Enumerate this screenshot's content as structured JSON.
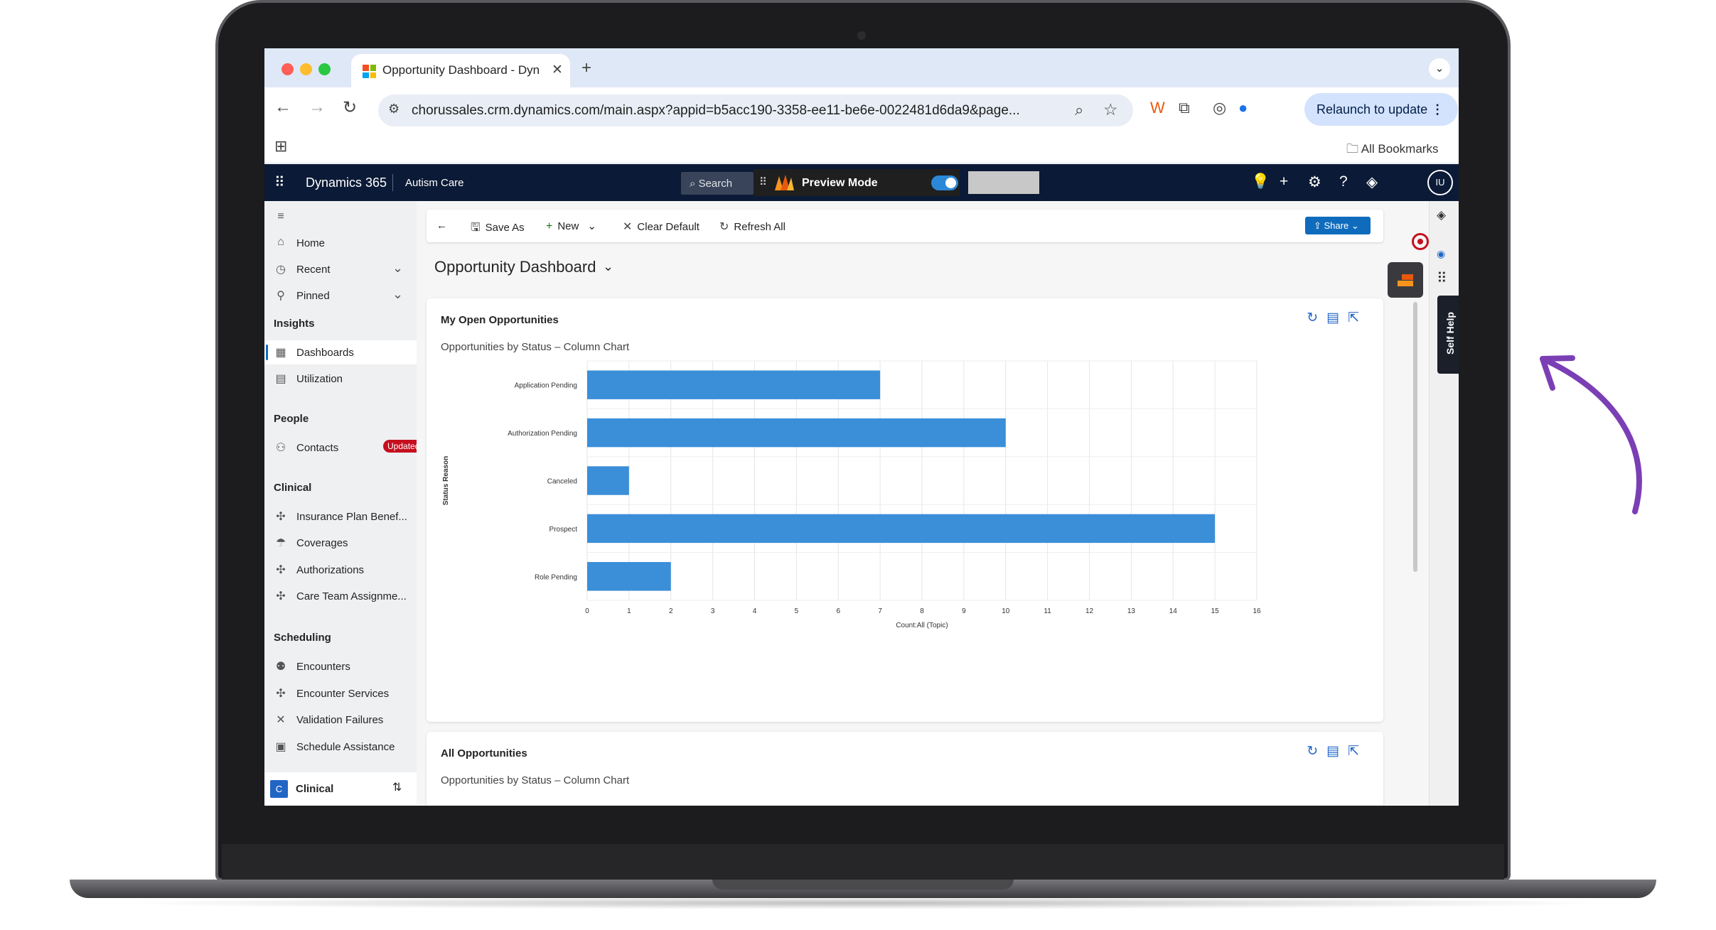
{
  "browser": {
    "tab_title": "Opportunity Dashboard - Dyn",
    "tab_close": "✕",
    "new_tab": "+",
    "url": "chorussales.crm.dynamics.com/main.aspx?appid=b5acc190-3358-ee11-be6e-0022481d6da9&page...",
    "relaunch_label": "Relaunch to update",
    "all_bookmarks": "All Bookmarks"
  },
  "header": {
    "product": "Dynamics 365",
    "app": "Autism Care",
    "search_label": "Search",
    "preview_label": "Preview Mode",
    "avatar_initials": "IU"
  },
  "sitemap": {
    "home": "Home",
    "recent": "Recent",
    "pinned": "Pinned",
    "insights_group": "Insights",
    "dashboards": "Dashboards",
    "utilization": "Utilization",
    "people_group": "People",
    "contacts": "Contacts",
    "updated_badge": "Updated",
    "clinical_group": "Clinical",
    "insurance": "Insurance Plan Benef...",
    "coverages": "Coverages",
    "authorizations": "Authorizations",
    "care_team": "Care Team Assignme...",
    "scheduling_group": "Scheduling",
    "encounters": "Encounters",
    "encounter_services": "Encounter Services",
    "validation_failures": "Validation Failures",
    "schedule_assistance": "Schedule Assistance",
    "area_tile": "C",
    "area_name": "Clinical"
  },
  "commands": {
    "save_as": "Save As",
    "new": "New",
    "clear_default": "Clear Default",
    "refresh_all": "Refresh All",
    "share": "Share"
  },
  "dashboard": {
    "title": "Opportunity Dashboard"
  },
  "cards": [
    {
      "title": "My Open Opportunities",
      "subtitle": "Opportunities by Status – Column Chart"
    },
    {
      "title": "All Opportunities",
      "subtitle": "Opportunities by Status – Column Chart"
    }
  ],
  "side": {
    "self_help": "Self Help"
  },
  "colors": {
    "bar": "#3b8ed8",
    "header_bg": "#0b1a36",
    "accent": "#0f6cbd",
    "arrow": "#7b3fb5"
  },
  "chart_data": {
    "type": "bar",
    "orientation": "horizontal",
    "categories": [
      "Application Pending",
      "Authorization Pending",
      "Canceled",
      "Prospect",
      "Role Pending"
    ],
    "values": [
      7,
      10,
      1,
      15,
      2
    ],
    "xlabel": "Count:All (Topic)",
    "ylabel": "Status Reason",
    "xlim": [
      0,
      16
    ],
    "xticks": [
      "0",
      "1",
      "2",
      "3",
      "4",
      "5",
      "6",
      "7",
      "8",
      "9",
      "10",
      "11",
      "12",
      "13",
      "14",
      "15",
      "16"
    ],
    "grid": true
  }
}
